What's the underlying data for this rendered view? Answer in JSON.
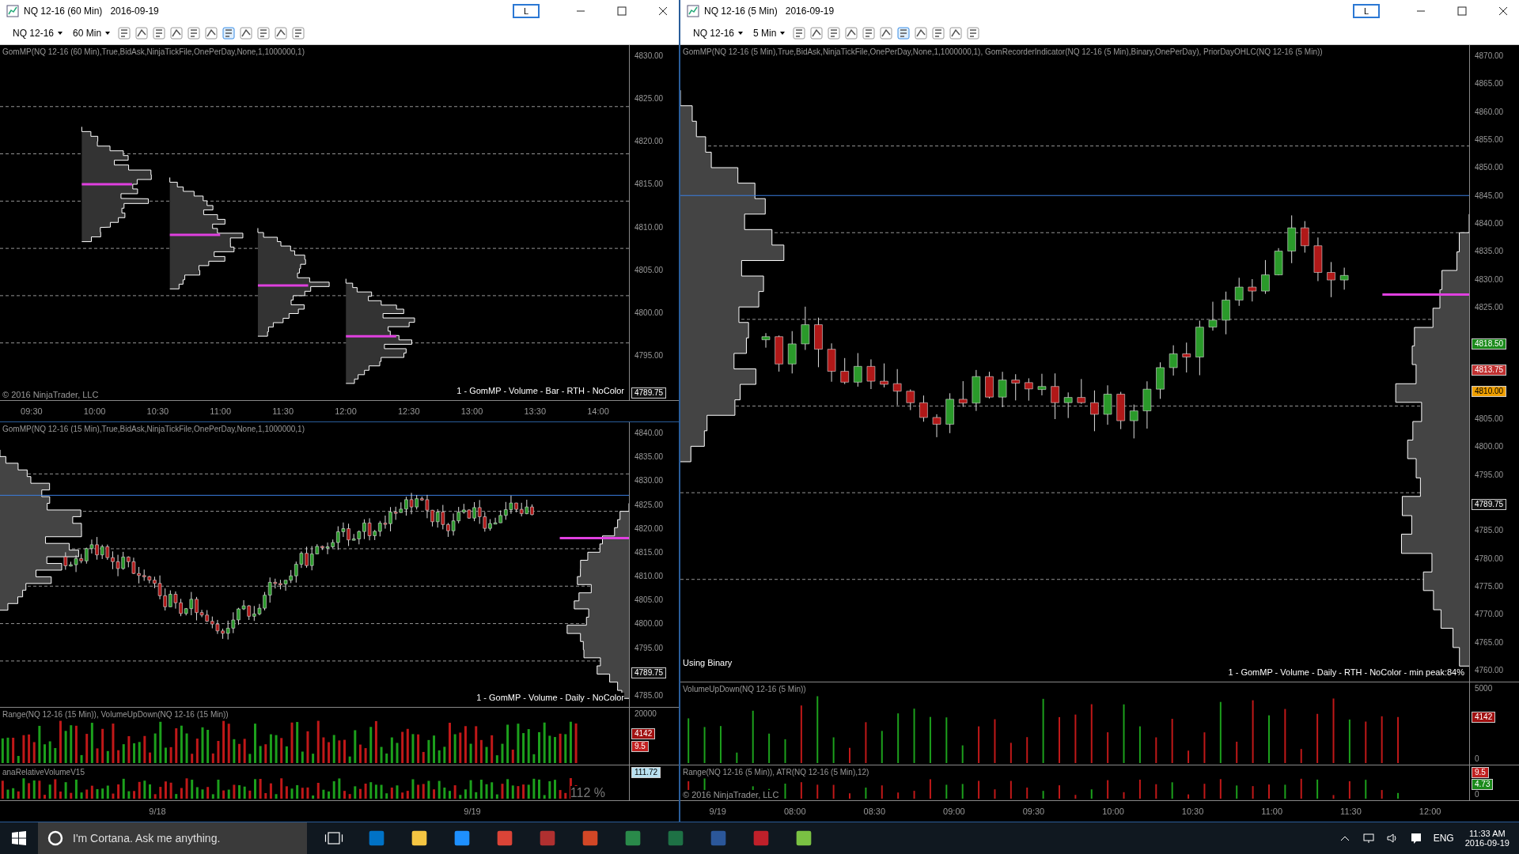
{
  "windows": [
    {
      "title": "NQ 12-16 (60 Min)",
      "date": "2016-09-19",
      "link_label": "L",
      "instrument": "NQ 12-16",
      "interval": "60 Min",
      "charts": [
        {
          "panels": [
            {
              "kind": "profile",
              "label": "GomMP(NQ 12-16 (60 Min),True,BidAsk,NinjaTickFile,OnePerDay,None,1,1000000,1)",
              "ticks": [
                "4830.00",
                "4825.00",
                "4820.00",
                "4815.00",
                "4810.00",
                "4805.00",
                "4800.00",
                "4795.00"
              ],
              "markers": [
                {
                  "text": "4789.75",
                  "color": "#101010"
                }
              ],
              "profile_label": "1 - GomMP - Volume - Bar - RTH - NoColor",
              "copyright": "© 2016 NinjaTrader, LLC"
            }
          ],
          "time_ticks": [
            "09:30",
            "10:00",
            "10:30",
            "11:00",
            "11:30",
            "12:00",
            "12:30",
            "13:00",
            "13:30",
            "14:00"
          ]
        },
        {
          "panels": [
            {
              "kind": "candles",
              "label": "GomMP(NQ 12-16 (15 Min),True,BidAsk,NinjaTickFile,OnePerDay,None,1,1000000,1)",
              "ticks": [
                "4840.00",
                "4835.00",
                "4830.00",
                "4825.00",
                "4820.00",
                "4815.00",
                "4810.00",
                "4805.00",
                "4800.00",
                "4795.00",
                "4785.00"
              ],
              "markers": [
                {
                  "text": "4789.75",
                  "color": "#101010"
                }
              ],
              "profile_label": "1 - GomMP - Volume - Daily - NoColor"
            },
            {
              "kind": "volume",
              "label": "Range(NQ 12-16 (15 Min)), VolumeUpDown(NQ 12-16 (15 Min))",
              "ticks": [
                "20000"
              ],
              "markers": [
                {
                  "text": "4142",
                  "color": "#a01010"
                },
                {
                  "text": "9.5",
                  "color": "#c02020"
                }
              ]
            },
            {
              "kind": "relative",
              "label": "anaRelativeVolumeV15",
              "reading": "112 %",
              "markers": [
                {
                  "text": "111.72",
                  "color": "#b8e0f0"
                }
              ]
            }
          ],
          "time_ticks": [
            "9/18",
            "9/19"
          ]
        }
      ]
    },
    {
      "title": "NQ 12-16 (5 Min)",
      "date": "2016-09-19",
      "link_label": "L",
      "instrument": "NQ 12-16",
      "interval": "5 Min",
      "charts": [
        {
          "panels": [
            {
              "kind": "candles",
              "label": "GomMP(NQ 12-16 (5 Min),True,BidAsk,NinjaTickFile,OnePerDay,None,1,1000000,1), GomRecorderIndicator(NQ 12-16 (5 Min),Binary,OnePerDay), PriorDayOHLC(NQ 12-16 (5 Min))",
              "ticks": [
                "4870.00",
                "4865.00",
                "4860.00",
                "4855.00",
                "4850.00",
                "4845.00",
                "4840.00",
                "4835.00",
                "4830.00",
                "4825.00",
                "4805.00",
                "4800.00",
                "4795.00",
                "4785.00",
                "4780.00",
                "4775.00",
                "4770.00",
                "4765.00",
                "4760.00"
              ],
              "markers": [
                {
                  "text": "4818.50",
                  "color": "#1a8a1a"
                },
                {
                  "text": "4813.75",
                  "color": "#c03030"
                },
                {
                  "text": "4810.00",
                  "color": "#f0a000"
                },
                {
                  "text": "4789.75",
                  "color": "#101010"
                }
              ],
              "note": "Using Binary",
              "profile_label": "1 - GomMP - Volume - Daily - RTH - NoColor - min peak:84%"
            },
            {
              "kind": "volume",
              "label": "VolumeUpDown(NQ 12-16 (5 Min))",
              "ticks": [
                "5000",
                "0"
              ],
              "markers": [
                {
                  "text": "4142",
                  "color": "#a01010"
                }
              ]
            },
            {
              "kind": "range",
              "label": "Range(NQ 12-16 (5 Min)), ATR(NQ 12-16 (5 Min),12)",
              "copyright": "© 2016 NinjaTrader, LLC",
              "ticks": [
                "0"
              ],
              "markers": [
                {
                  "text": "9.5",
                  "color": "#c02020"
                },
                {
                  "text": "4.73",
                  "color": "#1a8a1a"
                }
              ]
            }
          ],
          "time_ticks": [
            "9/19",
            "08:00",
            "08:30",
            "09:00",
            "09:30",
            "10:00",
            "10:30",
            "11:00",
            "11:30",
            "12:00"
          ]
        }
      ]
    }
  ],
  "taskbar": {
    "search_placeholder": "I'm Cortana. Ask me anything.",
    "language": "ENG",
    "time": "11:33 AM",
    "date": "2016-09-19"
  }
}
